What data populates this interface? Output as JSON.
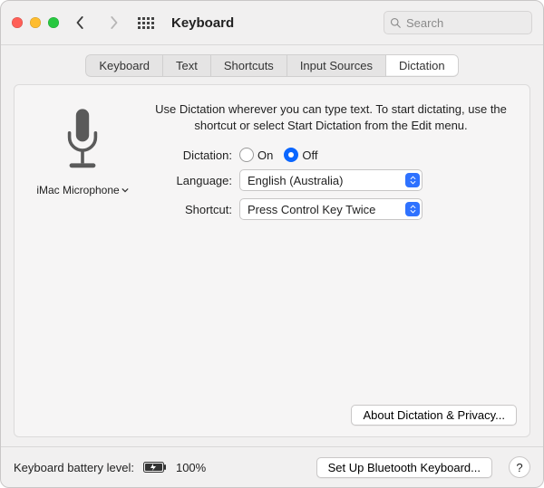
{
  "titlebar": {
    "title": "Keyboard",
    "search_placeholder": "Search"
  },
  "tabs": [
    "Keyboard",
    "Text",
    "Shortcuts",
    "Input Sources",
    "Dictation"
  ],
  "active_tab_index": 4,
  "dictation": {
    "intro": "Use Dictation wherever you can type text. To start dictating, use the shortcut or select Start Dictation from the Edit menu.",
    "mic_source": "iMac Microphone",
    "labels": {
      "dictation": "Dictation:",
      "language": "Language:",
      "shortcut": "Shortcut:"
    },
    "radio_on": "On",
    "radio_off": "Off",
    "radio_selected": "Off",
    "language_value": "English (Australia)",
    "shortcut_value": "Press Control Key Twice",
    "about_button": "About Dictation & Privacy..."
  },
  "footer": {
    "battery_label_prefix": "Keyboard battery level:",
    "battery_pct": "100%",
    "bluetooth_button": "Set Up Bluetooth Keyboard...",
    "help": "?"
  }
}
